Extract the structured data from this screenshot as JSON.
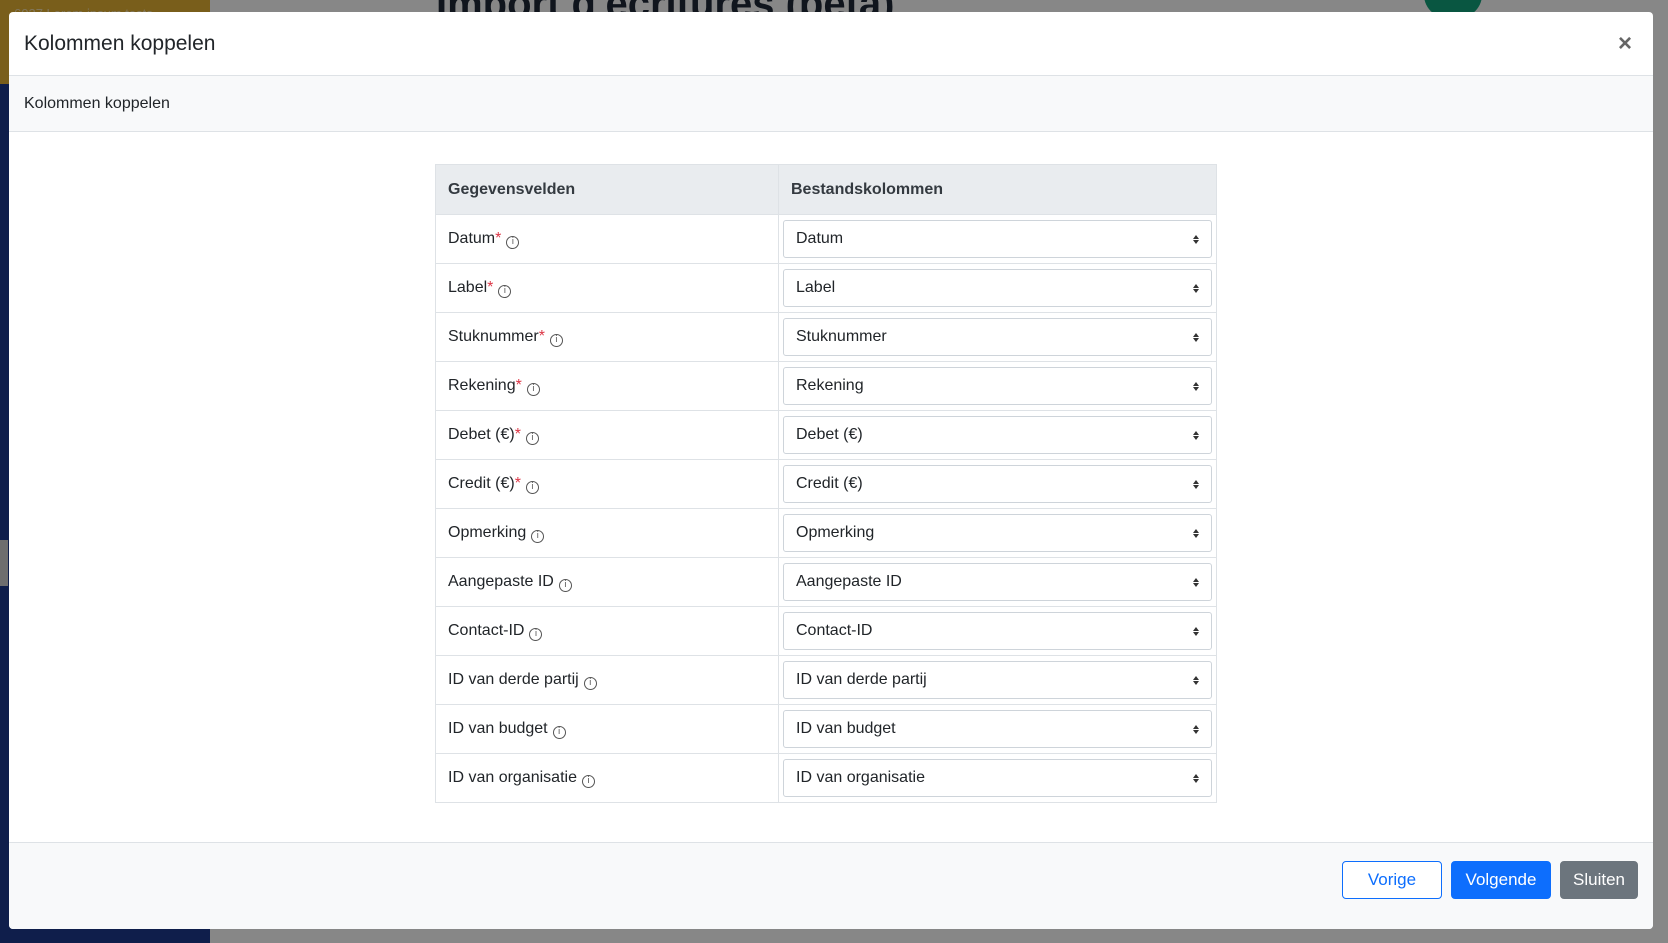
{
  "background": {
    "sidebar_text": "6037 Lorem ipsum tests",
    "page_title": "Import d'écritures (bêta)"
  },
  "modal": {
    "title": "Kolommen koppelen",
    "close_label": "×",
    "subheader": "Kolommen koppelen",
    "table": {
      "headers": [
        "Gegevensvelden",
        "Bestandskolommen"
      ],
      "rows": [
        {
          "field": "Datum",
          "required": "*",
          "column": "Datum"
        },
        {
          "field": "Label",
          "required": "*",
          "column": "Label"
        },
        {
          "field": "Stuknummer",
          "required": "*",
          "column": "Stuknummer"
        },
        {
          "field": "Rekening",
          "required": "*",
          "column": "Rekening"
        },
        {
          "field": "Debet (€)",
          "required": "*",
          "column": "Debet (€)"
        },
        {
          "field": "Credit (€)",
          "required": "*",
          "column": "Credit (€)"
        },
        {
          "field": "Opmerking",
          "required": "",
          "column": "Opmerking"
        },
        {
          "field": "Aangepaste ID",
          "required": "",
          "column": "Aangepaste ID"
        },
        {
          "field": "Contact-ID",
          "required": "",
          "column": "Contact-ID"
        },
        {
          "field": "ID van derde partij",
          "required": "",
          "column": "ID van derde partij"
        },
        {
          "field": "ID van budget",
          "required": "",
          "column": "ID van budget"
        },
        {
          "field": "ID van organisatie",
          "required": "",
          "column": "ID van organisatie"
        }
      ]
    },
    "footer": {
      "prev_label": "Vorige",
      "next_label": "Volgende",
      "close_label": "Sluiten"
    }
  },
  "icons": {
    "info": "info-icon",
    "close": "close-icon",
    "select_arrows": "chevron-updown-icon"
  },
  "colors": {
    "primary": "#0d6efd",
    "secondary": "#6c757d",
    "required": "#dc3545"
  }
}
